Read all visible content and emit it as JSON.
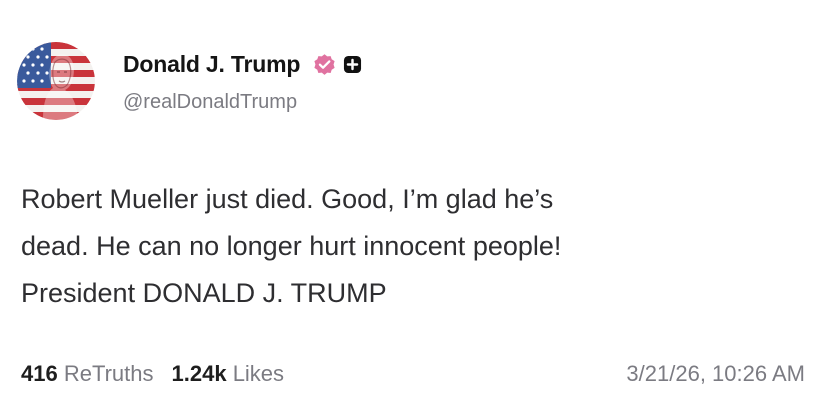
{
  "author": {
    "display_name": "Donald J. Trump",
    "handle": "@realDonaldTrump",
    "avatar_icon": "american-flag-portrait-avatar",
    "verified_icon": "verified-check-badge-icon",
    "plus_icon": "plus-square-badge-icon"
  },
  "post": {
    "lines": [
      "Robert Mueller just died. Good, I’m glad he’s",
      "dead. He can no longer hurt innocent people!",
      "President DONALD J. TRUMP"
    ]
  },
  "stats": {
    "retruths_count": "416",
    "retruths_label": "ReTruths",
    "likes_count": "1.24k",
    "likes_label": "Likes",
    "timestamp": "3/21/26, 10:26 AM"
  },
  "colors": {
    "verified_badge": "#e072a0",
    "plus_badge": "#111111",
    "flag_red": "#c9343b",
    "flag_blue": "#3a5a9c",
    "text_primary": "#151515",
    "text_secondary": "#7b7b82"
  }
}
